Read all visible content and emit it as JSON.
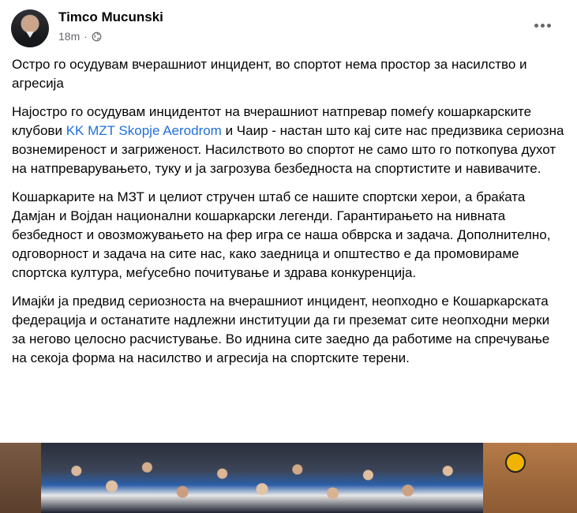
{
  "post": {
    "author": "Timco Mucunski",
    "time": "18m",
    "separator": "·",
    "privacy_icon": "globe-icon",
    "more_icon": "more-options-icon"
  },
  "content": {
    "p1": "Остро го осудувам вчерашниот инцидент, во спортот нема простор за насилство и агресија",
    "p2_before": "Најостро го осудувам инцидентот на вчерашниот натпревар помеѓу кошаркарските клубови ",
    "p2_link": "KK MZT Skopje Aerodrom",
    "p2_after": " и Чаир -  настан што кај сите нас предизвика сериозна вознемиреност и загриженост. Насилството во спортот не само што го поткопува духот на натпреварувањето, туку и ја загрозува безбедноста на спортистите и навивачите.",
    "p3": "Кошаркарите на МЗТ и целиот стручен штаб се нашите спортски херои, а браќата Дамјан и Војдан национални кошаркарски легенди. Гарантирањето на нивната безбедност и овозможувањето на фер игра се наша обврска и задача. Дополнително, одговорност и задача на сите нас, како заедница и општество е да промовираме спортска култура, меѓусебно почитување и здрава конкуренција.",
    "p4": "Имајќи ја предвид сериозноста на вчерашниот инцидент, неопходно е Кошаркарската федерација и останатите надлежни институции да ги преземат сите неопходни мерки за негово целосно расчистување. Во иднина сите заедно да работиме на спречување на секоја форма на насилство и агресија на спортските терени."
  },
  "colors": {
    "link": "#216fdb",
    "secondary_text": "#65676b"
  }
}
